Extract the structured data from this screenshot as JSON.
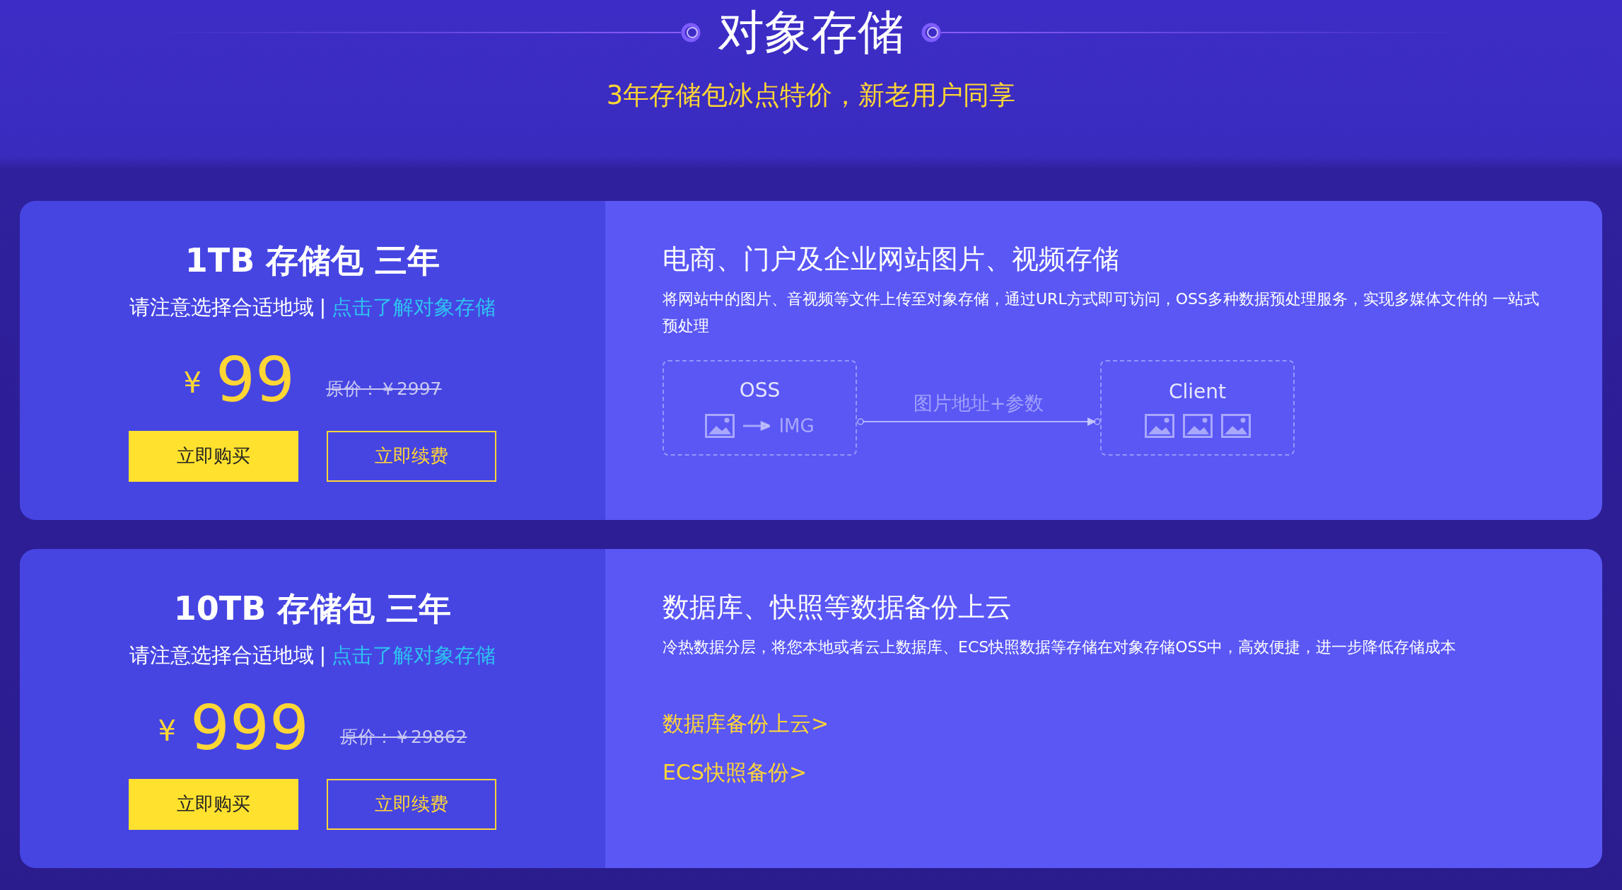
{
  "header": {
    "title": "对象存储",
    "subtitle": "3年存储包冰点特价，新老用户同享"
  },
  "plans": [
    {
      "title": "1TB 存储包 三年",
      "note": "请注意选择合适地域",
      "separator": "|",
      "link": "点击了解对象存储",
      "currency": "¥",
      "price": "99",
      "original_price": "原价：￥2997",
      "buttons": [
        {
          "label": "立即购买",
          "kind": "primary"
        },
        {
          "label": "立即续费",
          "kind": "outline"
        }
      ],
      "feature": {
        "kind": "diagram",
        "heading": "电商、门户及企业网站图片、视频存储",
        "description": "将网站中的图片、音视频等文件上传至对象存储，通过URL方式即可访问，OSS多种数据预处理服务，实现多媒体文件的 一站式预处理",
        "diagram": {
          "source": "OSS",
          "output": "IMG",
          "arrow_label": "图片地址+参数",
          "target": "Client"
        }
      }
    },
    {
      "title": "10TB 存储包 三年",
      "note": "请注意选择合适地域",
      "separator": "|",
      "link": "点击了解对象存储",
      "currency": "¥",
      "price": "999",
      "original_price": "原价：￥29862",
      "buttons": [
        {
          "label": "立即购买",
          "kind": "primary"
        },
        {
          "label": "立即续费",
          "kind": "outline"
        }
      ],
      "feature": {
        "kind": "links",
        "heading": "数据库、快照等数据备份上云",
        "description": "冷热数据分层，将您本地或者云上数据库、ECS快照数据等存储在对象存储OSS中，高效便捷，进一步降低存储成本",
        "links": [
          "数据库备份上云>",
          "ECS快照备份>"
        ]
      }
    }
  ]
}
